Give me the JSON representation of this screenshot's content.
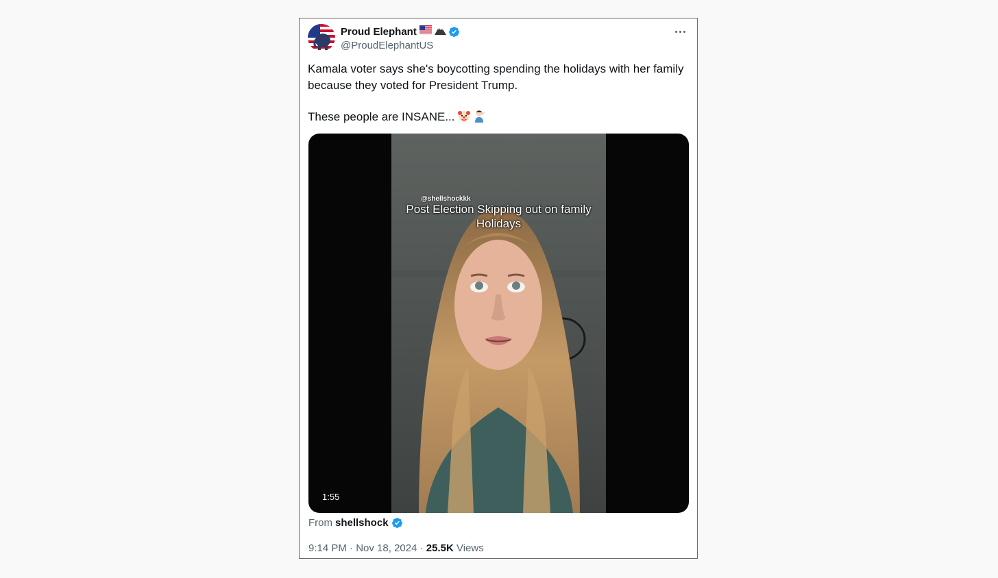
{
  "tweet": {
    "display_name": "Proud Elephant",
    "handle": "@ProudElephantUS",
    "text_line1": "Kamala voter says she's boycotting spending the holidays with her family because they voted for President Trump.",
    "text_line2": "These people are INSANE...",
    "emojis": [
      "clown-face",
      "facepalm"
    ],
    "badges": [
      "us-flag",
      "mountain",
      "verified-badge"
    ]
  },
  "media": {
    "watermark": "@shellshockkk",
    "caption": "Post Election Skipping out on family Holidays",
    "duration": "1:55"
  },
  "source": {
    "prefix": "From",
    "name": "shellshock"
  },
  "meta": {
    "time": "9:14 PM",
    "date": "Nov 18, 2024",
    "views_count": "25.5K",
    "views_label": "Views",
    "separator": "·"
  },
  "colors": {
    "verified": "#1d9bf0",
    "secondary_text": "#536471",
    "primary_text": "#0f1419"
  }
}
